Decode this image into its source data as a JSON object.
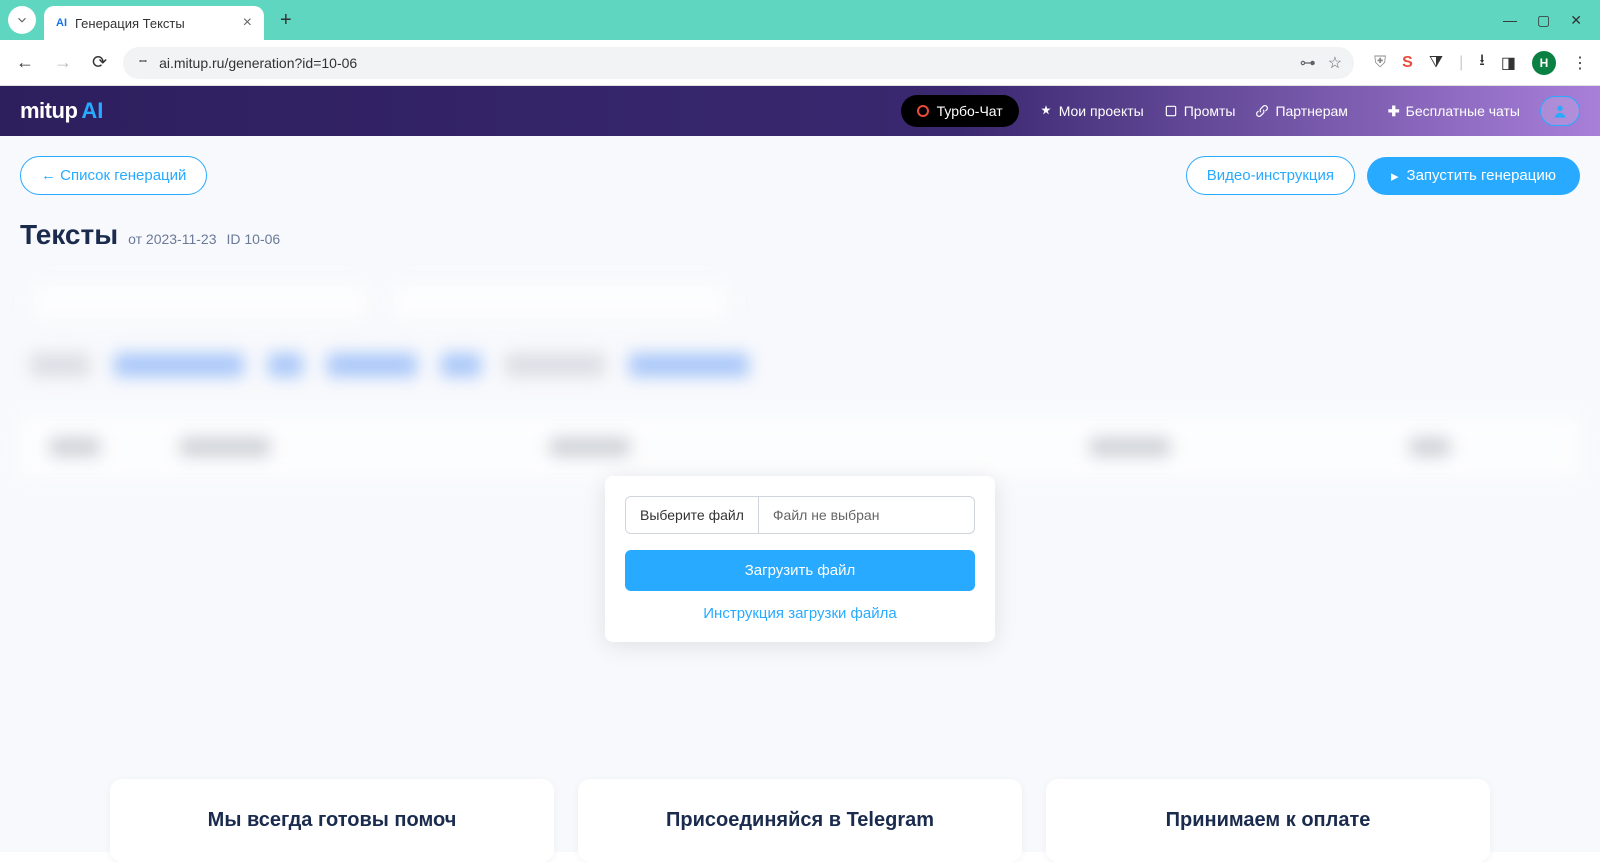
{
  "browser": {
    "tab_title": "Генерация Тексты",
    "tab_favicon": "AI",
    "url": "ai.mitup.ru/generation?id=10-06",
    "avatar_letter": "Н"
  },
  "header": {
    "logo_text": "mitup",
    "logo_ai": "AI",
    "turbo_chat": "Турбо-Чат",
    "nav": {
      "projects": "Мои проекты",
      "prompts": "Промты",
      "partners": "Партнерам",
      "free_chats": "Бесплатные чаты"
    }
  },
  "actions": {
    "back_to_list": "← Список генераций",
    "video_instruction": "Видео-инструкция",
    "run_generation": "Запустить генерацию"
  },
  "page": {
    "title": "Тексты",
    "date_prefix": "от",
    "date": "2023-11-23",
    "id_prefix": "ID",
    "id": "10-06"
  },
  "modal": {
    "choose_file": "Выберите файл",
    "no_file": "Файл не выбран",
    "upload": "Загрузить файл",
    "instruction": "Инструкция загрузки файла"
  },
  "footer": {
    "card1": "Мы всегда готовы помоч",
    "card2": "Присоединяйся в Telegram",
    "card3": "Принимаем к оплате"
  }
}
